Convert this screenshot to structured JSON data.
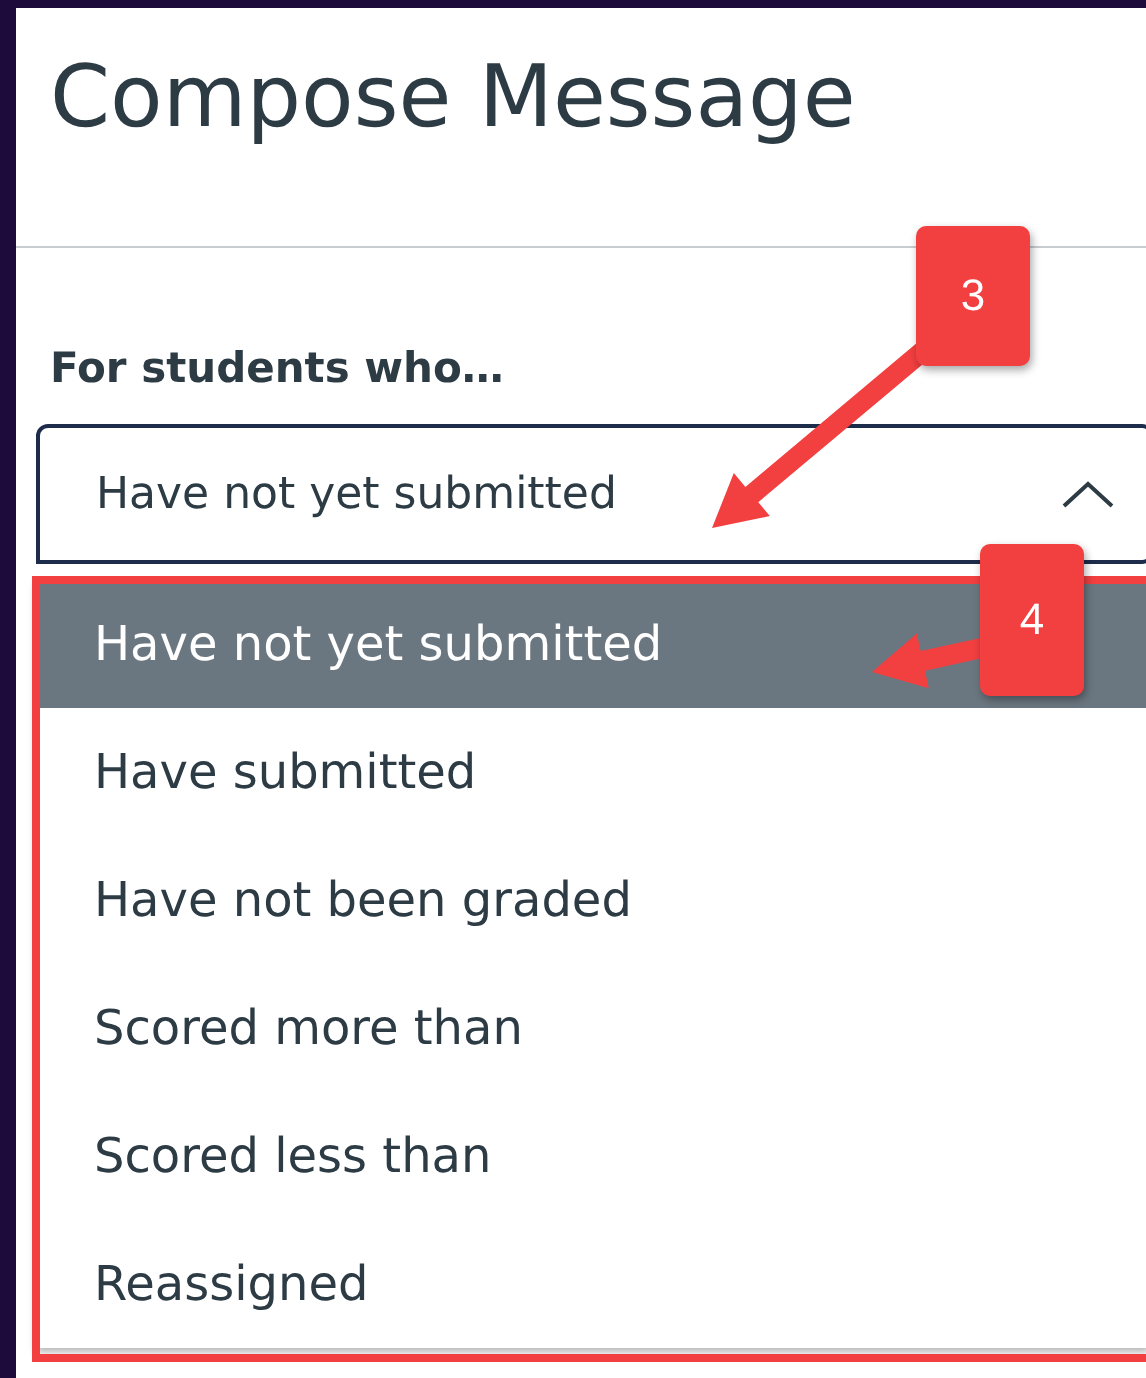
{
  "title": "Compose Message",
  "filter": {
    "label": "For students who…",
    "value": "Have not yet submitted",
    "expanded": true,
    "options": [
      {
        "label": "Have not yet submitted",
        "selected": true
      },
      {
        "label": "Have submitted",
        "selected": false
      },
      {
        "label": "Have not been graded",
        "selected": false
      },
      {
        "label": "Scored more than",
        "selected": false
      },
      {
        "label": "Scored less than",
        "selected": false
      },
      {
        "label": "Reassigned",
        "selected": false
      }
    ]
  },
  "annotations": [
    {
      "label": "3"
    },
    {
      "label": "4"
    }
  ]
}
